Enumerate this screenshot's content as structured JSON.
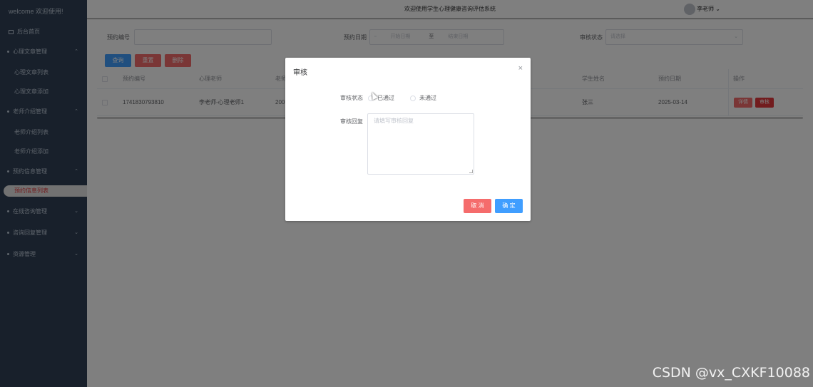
{
  "sidebar": {
    "brand": "welcome 欢迎使用!",
    "home": "后台首页",
    "groups": [
      {
        "label": "心理文章管理",
        "items": [
          "心理文章列表",
          "心理文章添加"
        ]
      },
      {
        "label": "老师介绍管理",
        "items": [
          "老师介绍列表",
          "老师介绍添加"
        ]
      },
      {
        "label": "预约信息管理",
        "items": [
          "预约信息列表"
        ]
      },
      {
        "label": "在线咨询管理",
        "items": []
      },
      {
        "label": "咨询回复管理",
        "items": []
      },
      {
        "label": "资源管理",
        "items": []
      }
    ]
  },
  "header": {
    "title": "欢迎使用学生心理健康咨询评估系统",
    "user": "李老师"
  },
  "filters": {
    "booking_no_label": "预约编号",
    "date_label": "预约日期",
    "date_start_placeholder": "开始日期",
    "date_sep": "至",
    "date_end_placeholder": "结束日期",
    "status_label": "审核状态",
    "status_placeholder": "请选择"
  },
  "actions": {
    "query": "查询",
    "reset": "重置",
    "delete": "删除"
  },
  "table": {
    "headers": [
      "预约编号",
      "心理老师",
      "老师",
      "学生姓名",
      "预约日期",
      "操作"
    ],
    "rows": [
      {
        "booking_no": "1741830793810",
        "teacher": "李老师-心理老师1",
        "col3": "200",
        "student": "张三",
        "date": "2025-03-14",
        "op_detail": "详情",
        "op_audit": "审核"
      }
    ]
  },
  "dialog": {
    "title": "审核",
    "status_label": "审核状态",
    "option_pass": "已通过",
    "option_fail": "未通过",
    "reply_label": "审核回复",
    "reply_placeholder": "请填写审核回复",
    "cancel": "取 消",
    "confirm": "确 定"
  },
  "watermark": "CSDN @vx_CXKF10088",
  "colors": {
    "sidebar_bg": "#304156",
    "primary": "#409eff",
    "danger": "#f56c6c",
    "active_text": "#e4393c"
  }
}
